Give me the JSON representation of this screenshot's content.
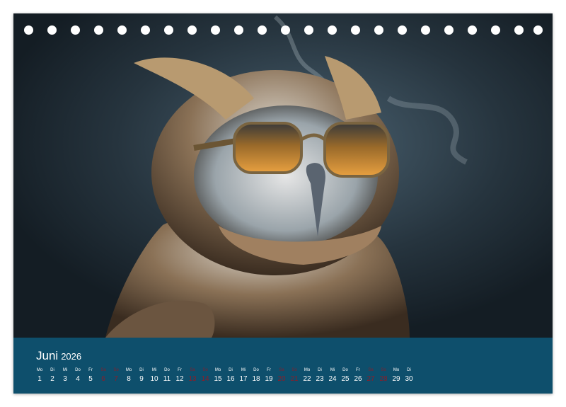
{
  "calendar": {
    "month": "Juni",
    "year": "2026",
    "days": [
      {
        "wd": "Mo",
        "d": "1",
        "weekend": false
      },
      {
        "wd": "Di",
        "d": "2",
        "weekend": false
      },
      {
        "wd": "Mi",
        "d": "3",
        "weekend": false
      },
      {
        "wd": "Do",
        "d": "4",
        "weekend": false
      },
      {
        "wd": "Fr",
        "d": "5",
        "weekend": false
      },
      {
        "wd": "Sa",
        "d": "6",
        "weekend": true
      },
      {
        "wd": "So",
        "d": "7",
        "weekend": true
      },
      {
        "wd": "Mo",
        "d": "8",
        "weekend": false
      },
      {
        "wd": "Di",
        "d": "9",
        "weekend": false
      },
      {
        "wd": "Mi",
        "d": "10",
        "weekend": false
      },
      {
        "wd": "Do",
        "d": "11",
        "weekend": false
      },
      {
        "wd": "Fr",
        "d": "12",
        "weekend": false
      },
      {
        "wd": "Sa",
        "d": "13",
        "weekend": true
      },
      {
        "wd": "So",
        "d": "14",
        "weekend": true
      },
      {
        "wd": "Mo",
        "d": "15",
        "weekend": false
      },
      {
        "wd": "Di",
        "d": "16",
        "weekend": false
      },
      {
        "wd": "Mi",
        "d": "17",
        "weekend": false
      },
      {
        "wd": "Do",
        "d": "18",
        "weekend": false
      },
      {
        "wd": "Fr",
        "d": "19",
        "weekend": false
      },
      {
        "wd": "Sa",
        "d": "20",
        "weekend": true
      },
      {
        "wd": "So",
        "d": "21",
        "weekend": true
      },
      {
        "wd": "Mo",
        "d": "22",
        "weekend": false
      },
      {
        "wd": "Di",
        "d": "23",
        "weekend": false
      },
      {
        "wd": "Mi",
        "d": "24",
        "weekend": false
      },
      {
        "wd": "Do",
        "d": "25",
        "weekend": false
      },
      {
        "wd": "Fr",
        "d": "26",
        "weekend": false
      },
      {
        "wd": "Sa",
        "d": "27",
        "weekend": true
      },
      {
        "wd": "So",
        "d": "28",
        "weekend": true
      },
      {
        "wd": "Mo",
        "d": "29",
        "weekend": false
      },
      {
        "wd": "Di",
        "d": "30",
        "weekend": false
      }
    ]
  },
  "colors": {
    "bar": "#0e4f6c",
    "weekend": "#8a1e2a",
    "text": "#ffffff"
  },
  "photo": {
    "subject": "owl-with-sunglasses"
  }
}
